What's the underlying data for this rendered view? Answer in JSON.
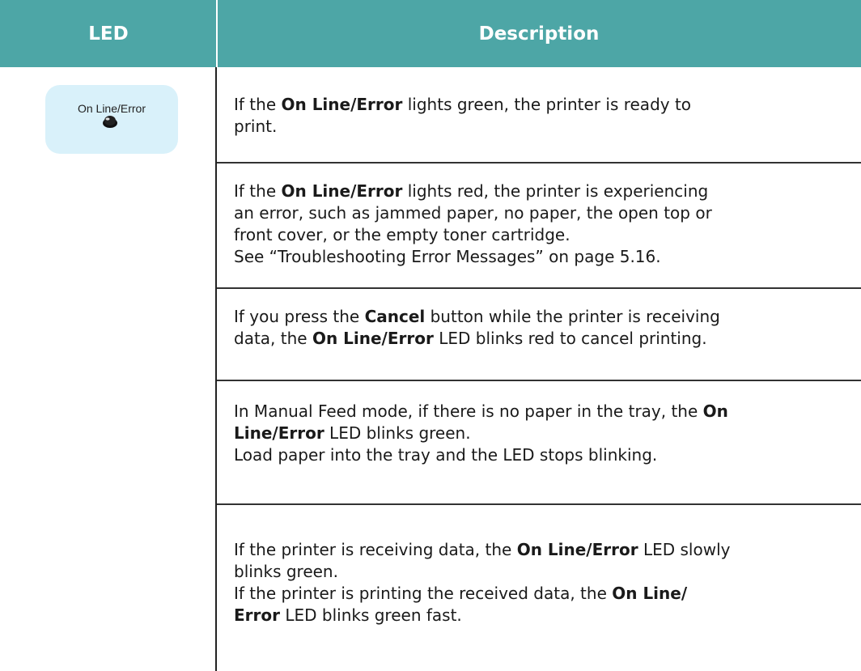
{
  "header": {
    "led": "LED",
    "description": "Description"
  },
  "led_indicator": {
    "label": "On Line/Error"
  },
  "rows": [
    {
      "lines": [
        [
          {
            "t": "If the "
          },
          {
            "t": "On Line/Error",
            "b": true
          },
          {
            "t": " lights green, the printer is ready to"
          }
        ],
        [
          {
            "t": "print."
          }
        ]
      ]
    },
    {
      "lines": [
        [
          {
            "t": "If the "
          },
          {
            "t": "On Line/Error",
            "b": true
          },
          {
            "t": " lights red, the printer is experiencing"
          }
        ],
        [
          {
            "t": "an error, such as jammed paper, no paper, the open top or"
          }
        ],
        [
          {
            "t": "front cover, or the empty toner cartridge."
          }
        ],
        [
          {
            "t": "See “Troubleshooting Error Messages” on page 5.16."
          }
        ]
      ]
    },
    {
      "lines": [
        [
          {
            "t": "If you press the "
          },
          {
            "t": "Cancel",
            "b": true
          },
          {
            "t": " button while the printer is receiving"
          }
        ],
        [
          {
            "t": "data, the "
          },
          {
            "t": "On Line/Error",
            "b": true
          },
          {
            "t": " LED blinks red to cancel printing."
          }
        ]
      ]
    },
    {
      "lines": [
        [
          {
            "t": "In Manual Feed mode, if there is no paper in the tray, the "
          },
          {
            "t": "On",
            "b": true
          }
        ],
        [
          {
            "t": "Line/Error",
            "b": true
          },
          {
            "t": " LED blinks green."
          }
        ],
        [
          {
            "t": "Load paper into the tray and the LED stops blinking."
          }
        ]
      ]
    },
    {
      "lines": [
        [
          {
            "t": "If the printer is receiving data, the "
          },
          {
            "t": "On Line/Error",
            "b": true
          },
          {
            "t": " LED slowly"
          }
        ],
        [
          {
            "t": "blinks green."
          }
        ],
        [
          {
            "t": "If the printer is printing the received data, the "
          },
          {
            "t": "On Line/",
            "b": true
          }
        ],
        [
          {
            "t": "Error",
            "b": true
          },
          {
            "t": " LED blinks green fast."
          }
        ]
      ]
    }
  ]
}
